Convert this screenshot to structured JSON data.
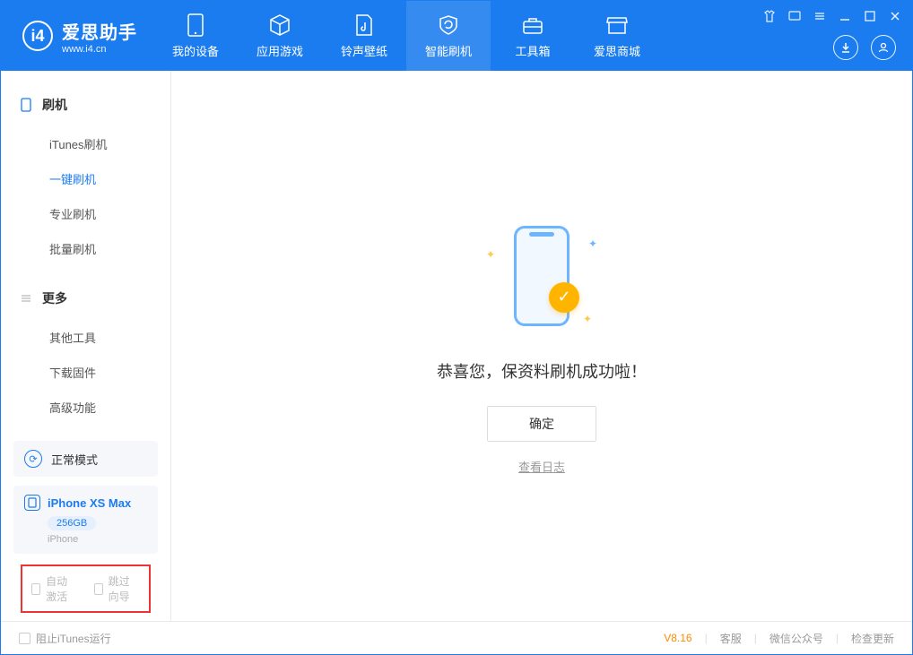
{
  "app": {
    "name_cn": "爱思助手",
    "name_en": "www.i4.cn"
  },
  "nav": [
    {
      "label": "我的设备"
    },
    {
      "label": "应用游戏"
    },
    {
      "label": "铃声壁纸"
    },
    {
      "label": "智能刷机",
      "active": true
    },
    {
      "label": "工具箱"
    },
    {
      "label": "爱思商城"
    }
  ],
  "sidebar": {
    "group1_title": "刷机",
    "group1": [
      {
        "label": "iTunes刷机"
      },
      {
        "label": "一键刷机",
        "active": true
      },
      {
        "label": "专业刷机"
      },
      {
        "label": "批量刷机"
      }
    ],
    "group2_title": "更多",
    "group2": [
      {
        "label": "其他工具"
      },
      {
        "label": "下载固件"
      },
      {
        "label": "高级功能"
      }
    ],
    "mode_label": "正常模式",
    "device": {
      "name": "iPhone XS Max",
      "storage": "256GB",
      "type": "iPhone"
    },
    "checkbox1": "自动激活",
    "checkbox2": "跳过向导"
  },
  "main": {
    "success_text": "恭喜您，保资料刷机成功啦！",
    "ok_button": "确定",
    "view_log": "查看日志"
  },
  "footer": {
    "block_itunes": "阻止iTunes运行",
    "version": "V8.16",
    "link1": "客服",
    "link2": "微信公众号",
    "link3": "检查更新"
  }
}
